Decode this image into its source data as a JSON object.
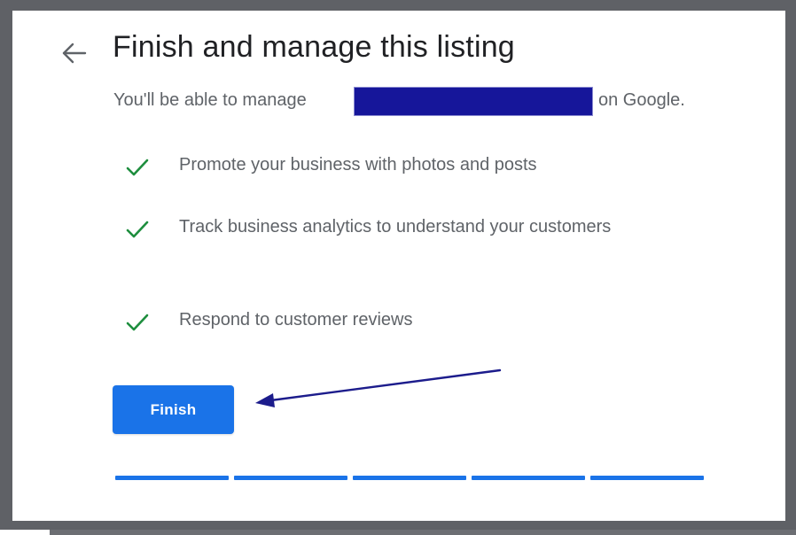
{
  "header": {
    "back_icon": "arrow-left-icon",
    "title": "Finish and manage this listing"
  },
  "subtitle": {
    "prefix": "You'll be able to manage",
    "suffix": "on Google."
  },
  "features": [
    {
      "icon": "check-icon",
      "text": "Promote your business with photos and posts"
    },
    {
      "icon": "check-icon",
      "text": "Track business analytics to understand your customers"
    },
    {
      "icon": "check-icon",
      "text": "Respond to customer reviews"
    }
  ],
  "actions": {
    "finish_label": "Finish"
  },
  "progress": {
    "steps_total": 5,
    "steps_completed": 5
  },
  "colors": {
    "primary": "#1a73e8",
    "check": "#1e8e3e",
    "redaction": "#16169a",
    "annotation_arrow": "#1c1c8c",
    "frame": "#5f6166"
  }
}
